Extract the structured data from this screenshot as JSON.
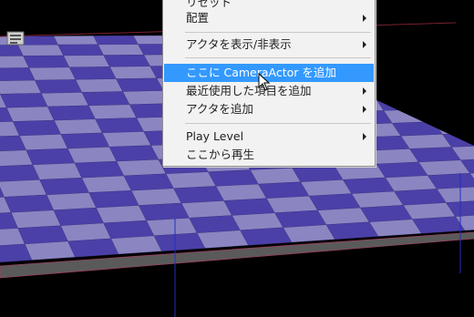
{
  "menu": {
    "items": [
      {
        "label": "リセット",
        "arrow": false
      },
      {
        "label": "配置",
        "arrow": true
      },
      {
        "label": "アクタを表示/非表示",
        "arrow": true
      },
      {
        "label": "ここに CameraActor を追加",
        "arrow": false,
        "highlighted": true
      },
      {
        "label": "最近使用した項目を追加",
        "arrow": true
      },
      {
        "label": "アクタを追加",
        "arrow": true
      },
      {
        "label": "Play Level",
        "arrow": true
      },
      {
        "label": "ここから再生",
        "arrow": false
      }
    ]
  },
  "colors": {
    "floor_dark": "#4b40a8",
    "floor_light": "#8b86c2",
    "highlight": "#3399ff",
    "menu_bg": "#f2f2f2"
  }
}
